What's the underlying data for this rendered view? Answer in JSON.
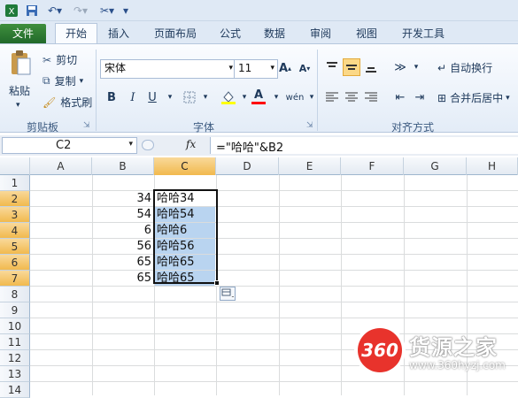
{
  "tabs": [
    "文件",
    "开始",
    "插入",
    "页面布局",
    "公式",
    "数据",
    "审阅",
    "视图",
    "开发工具"
  ],
  "clipboard": {
    "paste": "粘贴",
    "cut": "剪切",
    "copy": "复制",
    "format_painter": "格式刷",
    "group": "剪贴板"
  },
  "font": {
    "name": "宋体",
    "size": "11",
    "bold": "B",
    "italic": "I",
    "underline": "U",
    "font_color_glyph": "A",
    "group": "字体"
  },
  "alignment": {
    "wrap": "自动换行",
    "merge": "合并后居中",
    "group": "对齐方式"
  },
  "formula_bar": {
    "name_box": "C2",
    "fx": "fx",
    "formula": "=\"哈哈\"&B2"
  },
  "columns": [
    "A",
    "B",
    "C",
    "D",
    "E",
    "F",
    "G",
    "H"
  ],
  "rows": [
    "1",
    "2",
    "3",
    "4",
    "5",
    "6",
    "7",
    "8",
    "9",
    "10",
    "11",
    "12",
    "13",
    "14"
  ],
  "column_b": [
    "34",
    "54",
    "6",
    "56",
    "65",
    "65"
  ],
  "column_c": [
    "哈哈34",
    "哈哈54",
    "哈哈6",
    "哈哈56",
    "哈哈65",
    "哈哈65"
  ],
  "watermark": {
    "logo": "360",
    "brand": "货源之家",
    "url": "www.360hyzj.com"
  },
  "colors": {
    "file_tab": "#2a7a2f",
    "selection": "#b9d4f0",
    "header_selected": "#f3c25f"
  }
}
